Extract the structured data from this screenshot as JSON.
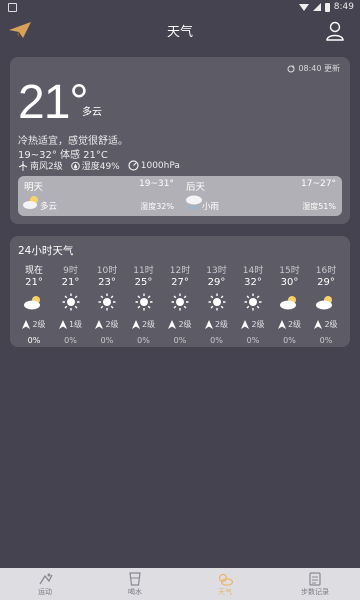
{
  "status_bar": {
    "time": "8:49"
  },
  "header": {
    "title": "天气"
  },
  "now": {
    "updated": "08:40 更新",
    "temperature": "21°",
    "condition": "多云",
    "tip": "冷热适宜，感觉很舒适。",
    "range_feel": "19~32°  体感 21°C",
    "wind": "南风2级",
    "humidity": "湿度49%",
    "pressure": "1000hPa"
  },
  "forecast": [
    {
      "day": "明天",
      "range": "19~31°",
      "condition": "多云",
      "humidity": "湿度32%",
      "icon": "partly-cloudy-icon"
    },
    {
      "day": "后天",
      "range": "17~27°",
      "condition": "小雨",
      "humidity": "湿度51%",
      "icon": "light-rain-icon"
    }
  ],
  "hourly": {
    "title": "24小时天气",
    "items": [
      {
        "time": "现在",
        "temp": "21°",
        "icon": "partly-cloudy-icon",
        "wind": "2级",
        "precip": "0%"
      },
      {
        "time": "9时",
        "temp": "21°",
        "icon": "sunny-icon",
        "wind": "1级",
        "precip": "0%"
      },
      {
        "time": "10时",
        "temp": "23°",
        "icon": "sunny-icon",
        "wind": "2级",
        "precip": "0%"
      },
      {
        "time": "11时",
        "temp": "25°",
        "icon": "sunny-icon",
        "wind": "2级",
        "precip": "0%"
      },
      {
        "time": "12时",
        "temp": "27°",
        "icon": "sunny-icon",
        "wind": "2级",
        "precip": "0%"
      },
      {
        "time": "13时",
        "temp": "29°",
        "icon": "sunny-icon",
        "wind": "2级",
        "precip": "0%"
      },
      {
        "time": "14时",
        "temp": "32°",
        "icon": "sunny-icon",
        "wind": "2级",
        "precip": "0%"
      },
      {
        "time": "15时",
        "temp": "30°",
        "icon": "partly-cloudy-icon",
        "wind": "2级",
        "precip": "0%"
      },
      {
        "time": "16时",
        "temp": "29°",
        "icon": "partly-cloudy-icon",
        "wind": "2级",
        "precip": "0%"
      }
    ]
  },
  "tabs": [
    {
      "label": "运动",
      "icon": "exercise-icon",
      "active": false
    },
    {
      "label": "喝水",
      "icon": "water-cup-icon",
      "active": false
    },
    {
      "label": "天气",
      "icon": "weather-icon",
      "active": true
    },
    {
      "label": "步数记录",
      "icon": "step-record-icon",
      "active": false
    }
  ],
  "colors": {
    "background": "#44434f",
    "card": "#5c5b66",
    "forecast_box": "#b1b0b6",
    "tab_active": "#e8b66a",
    "sun": "#f5d26b"
  }
}
